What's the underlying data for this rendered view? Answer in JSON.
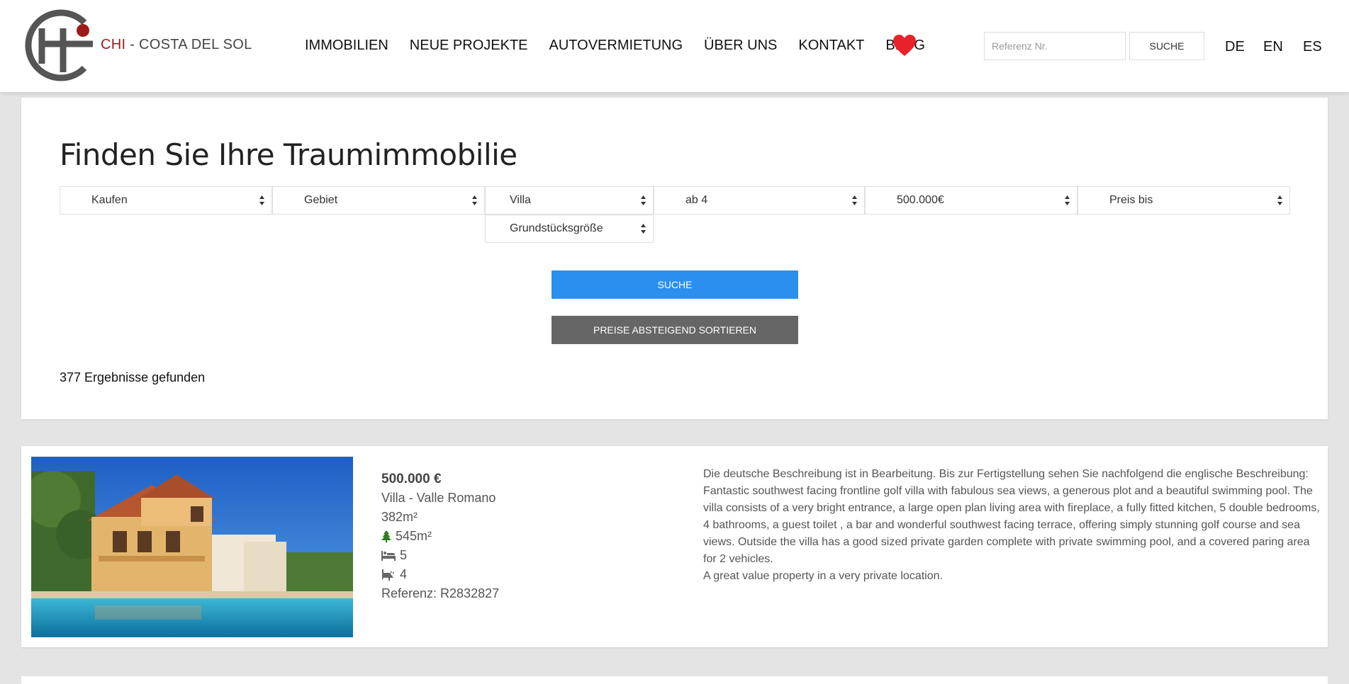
{
  "header": {
    "logo": {
      "brand": "CHI",
      "separator": " - ",
      "name": "COSTA DEL SOL"
    },
    "nav": [
      "IMMOBILIEN",
      "NEUE PROJEKTE",
      "AUTOVERMIETUNG",
      "ÜBER UNS",
      "KONTAKT",
      "BLOG"
    ],
    "favorites_icon": "heart-icon",
    "reference_search": {
      "placeholder": "Referenz Nr.",
      "value": "",
      "button_label": "SUCHE"
    },
    "languages": [
      "DE",
      "EN",
      "ES"
    ]
  },
  "search": {
    "title": "Finden Sie Ihre Traumimmobilie",
    "filters": {
      "operation": "Kaufen",
      "area": "Gebiet",
      "property_type": "Villa",
      "bedrooms": "ab 4",
      "price_from": "500.000€",
      "price_to": "Preis bis",
      "plot_size": "Grundstücksgröße"
    },
    "search_button": "SUCHE",
    "sort_button": "PREISE ABSTEIGEND SORTIEREN",
    "result_count": "377 Ergebnisse gefunden"
  },
  "listings": [
    {
      "price": "500.000 €",
      "title": "Villa - Valle Romano",
      "built_size": "382m²",
      "plot_size": "545m²",
      "bedrooms": "5",
      "bathrooms": "4",
      "reference": "Referenz: R2832827",
      "description_lines": [
        "Die deutsche Beschreibung ist in Bearbeitung. Bis zur Fertigstellung sehen Sie nachfolgend die englische Beschreibung:",
        "Fantastic southwest facing frontline golf villa with fabulous sea views, a generous plot and a beautiful swimming pool. The villa consists of a very bright entrance, a large open plan living area with fireplace, a fully fitted kitchen, 5 double bedrooms, 4 bathrooms, a guest toilet , a bar and wonderful southwest facing terrace, offering simply stunning golf course and sea views. Outside the villa has a good sized private garden complete with private swimming pool, and a covered paring area for 2 vehicles.",
        "A great value property in a very private location."
      ],
      "icons": {
        "plot": "tree-icon",
        "bedrooms": "bed-icon",
        "bathrooms": "bath-icon"
      }
    }
  ],
  "colors": {
    "brand_red": "#9e1b1b",
    "favorite_red": "#e8212b",
    "search_blue": "#2b8ff0",
    "sort_gray": "#666666",
    "page_bg": "#e4e4e4"
  }
}
